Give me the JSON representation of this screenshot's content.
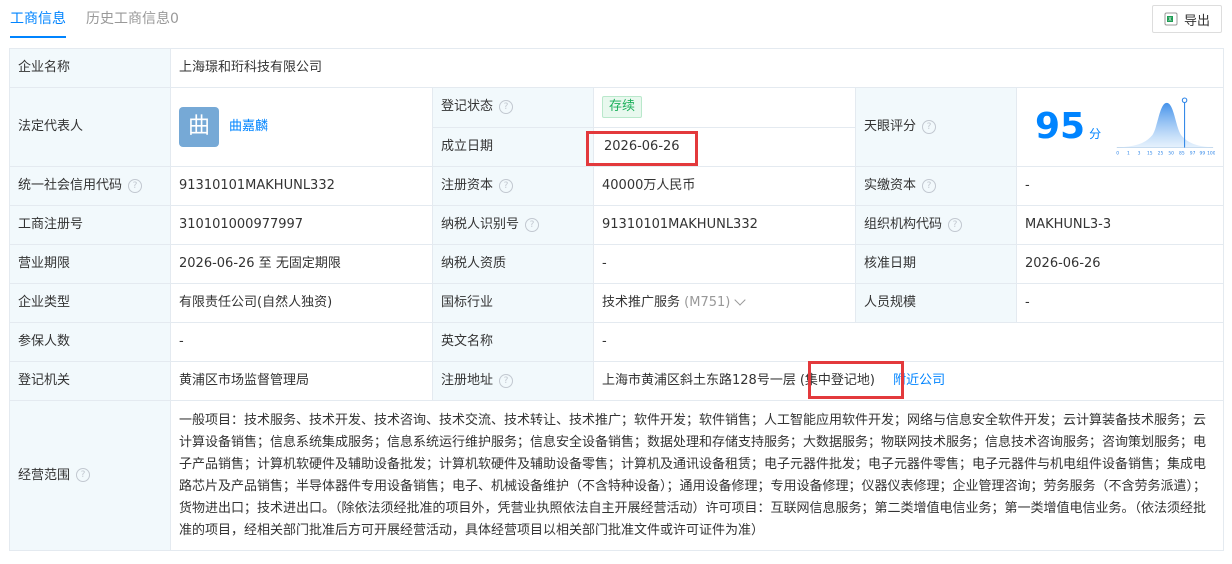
{
  "tabs": [
    {
      "label": "工商信息"
    },
    {
      "label": "历史工商信息0"
    }
  ],
  "export_label": "导出",
  "company": {
    "name_label": "企业名称",
    "name": "上海璟和珩科技有限公司",
    "legal_rep_label": "法定代表人",
    "legal_rep_avatar": "曲",
    "legal_rep_name": "曲嘉麟",
    "reg_status_label": "登记状态",
    "reg_status": "存续",
    "found_date_label": "成立日期",
    "found_date": "2026-06-26",
    "score_label": "天眼评分",
    "score": "95",
    "score_unit": "分",
    "score_axis": [
      "0",
      "1",
      "3",
      "15",
      "25",
      "50",
      "85",
      "97",
      "99",
      "100"
    ],
    "credit_code_label": "统一社会信用代码",
    "credit_code": "91310101MAKHUNL332",
    "reg_capital_label": "注册资本",
    "reg_capital": "40000万人民币",
    "paid_capital_label": "实缴资本",
    "paid_capital": "-",
    "biz_reg_no_label": "工商注册号",
    "biz_reg_no": "310101000977997",
    "taxpayer_id_label": "纳税人识别号",
    "taxpayer_id": "91310101MAKHUNL332",
    "org_code_label": "组织机构代码",
    "org_code": "MAKHUNL3-3",
    "term_label": "营业期限",
    "term": "2026-06-26 至 无固定期限",
    "taxpayer_qual_label": "纳税人资质",
    "taxpayer_qual": "-",
    "approve_date_label": "核准日期",
    "approve_date": "2026-06-26",
    "type_label": "企业类型",
    "type": "有限责任公司(自然人独资)",
    "industry_label": "国标行业",
    "industry": "技术推广服务",
    "industry_code": "(M751)",
    "staff_size_label": "人员规模",
    "staff_size": "-",
    "insured_label": "参保人数",
    "insured": "-",
    "en_name_label": "英文名称",
    "en_name": "-",
    "authority_label": "登记机关",
    "authority": "黄浦区市场监督管理局",
    "address_label": "注册地址",
    "address": "上海市黄浦区斜土东路128号一层",
    "address_note": "(集中登记地)",
    "nearby_label": "附近公司",
    "scope_label": "经营范围",
    "scope": "一般项目：技术服务、技术开发、技术咨询、技术交流、技术转让、技术推广；软件开发；软件销售；人工智能应用软件开发；网络与信息安全软件开发；云计算装备技术服务；云计算设备销售；信息系统集成服务；信息系统运行维护服务；信息安全设备销售；数据处理和存储支持服务；大数据服务；物联网技术服务；信息技术咨询服务；咨询策划服务；电子产品销售；计算机软硬件及辅助设备批发；计算机软硬件及辅助设备零售；计算机及通讯设备租赁；电子元器件批发；电子元器件零售；电子元器件与机电组件设备销售；集成电路芯片及产品销售；半导体器件专用设备销售；电子、机械设备维护（不含特种设备）；通用设备修理；专用设备修理；仪器仪表修理；企业管理咨询；劳务服务（不含劳务派遣）；货物进出口；技术进出口。（除依法须经批准的项目外，凭营业执照依法自主开展经营活动）许可项目：互联网信息服务；第二类增值电信业务；第一类增值电信业务。（依法须经批准的项目，经相关部门批准后方可开展经营活动，具体经营项目以相关部门批准文件或许可证件为准）"
  }
}
